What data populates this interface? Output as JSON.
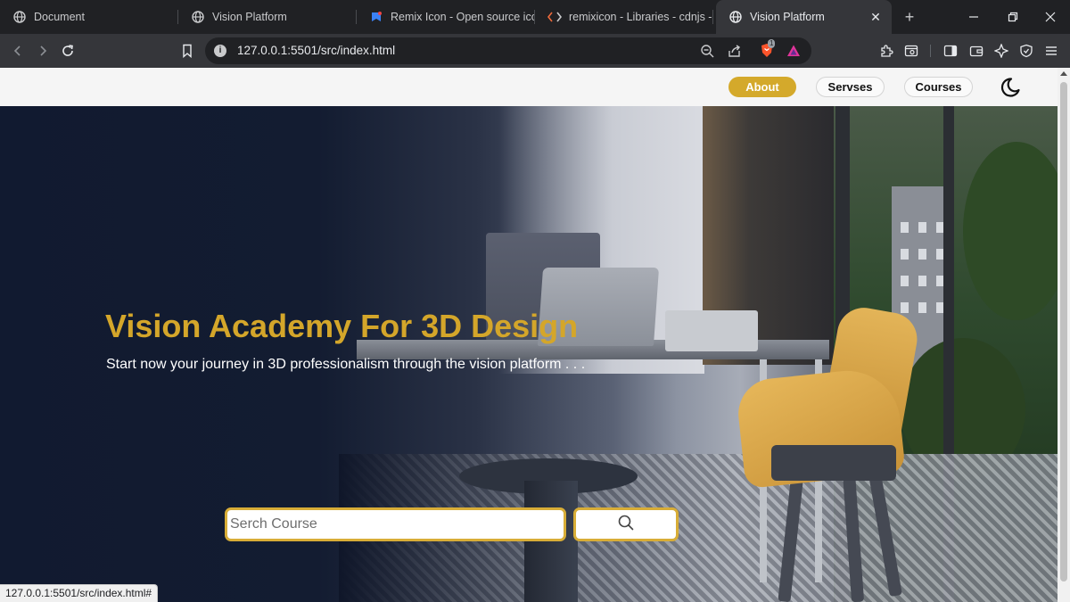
{
  "browser": {
    "tabs": [
      {
        "title": "Document",
        "favicon": "globe-icon"
      },
      {
        "title": "Vision Platform",
        "favicon": "globe-icon"
      },
      {
        "title": "Remix Icon - Open source icon",
        "favicon": "remix-icon"
      },
      {
        "title": "remixicon - Libraries - cdnjs - T",
        "favicon": "code-brackets-icon"
      },
      {
        "title": "Vision Platform",
        "favicon": "globe-icon",
        "active": true
      }
    ],
    "url": "127.0.0.1:5501/src/index.html",
    "shield_badge": "1",
    "status_url": "127.0.0.1:5501/src/index.html#"
  },
  "page": {
    "nav": {
      "items": [
        {
          "label": "About",
          "active": true
        },
        {
          "label": "Servses",
          "active": false
        },
        {
          "label": "Courses",
          "active": false
        }
      ],
      "theme_toggle_icon": "moon-icon"
    },
    "hero": {
      "title": "Vision Academy For 3D Design",
      "subtitle": "Start now your journey in 3D professionalism through the vision platform . . .",
      "search_placeholder": "Serch Course",
      "search_button_icon": "search-icon"
    }
  },
  "colors": {
    "accent": "#d4a62a",
    "hero_bg": "#111a30",
    "nav_bg": "#f5f5f5"
  }
}
